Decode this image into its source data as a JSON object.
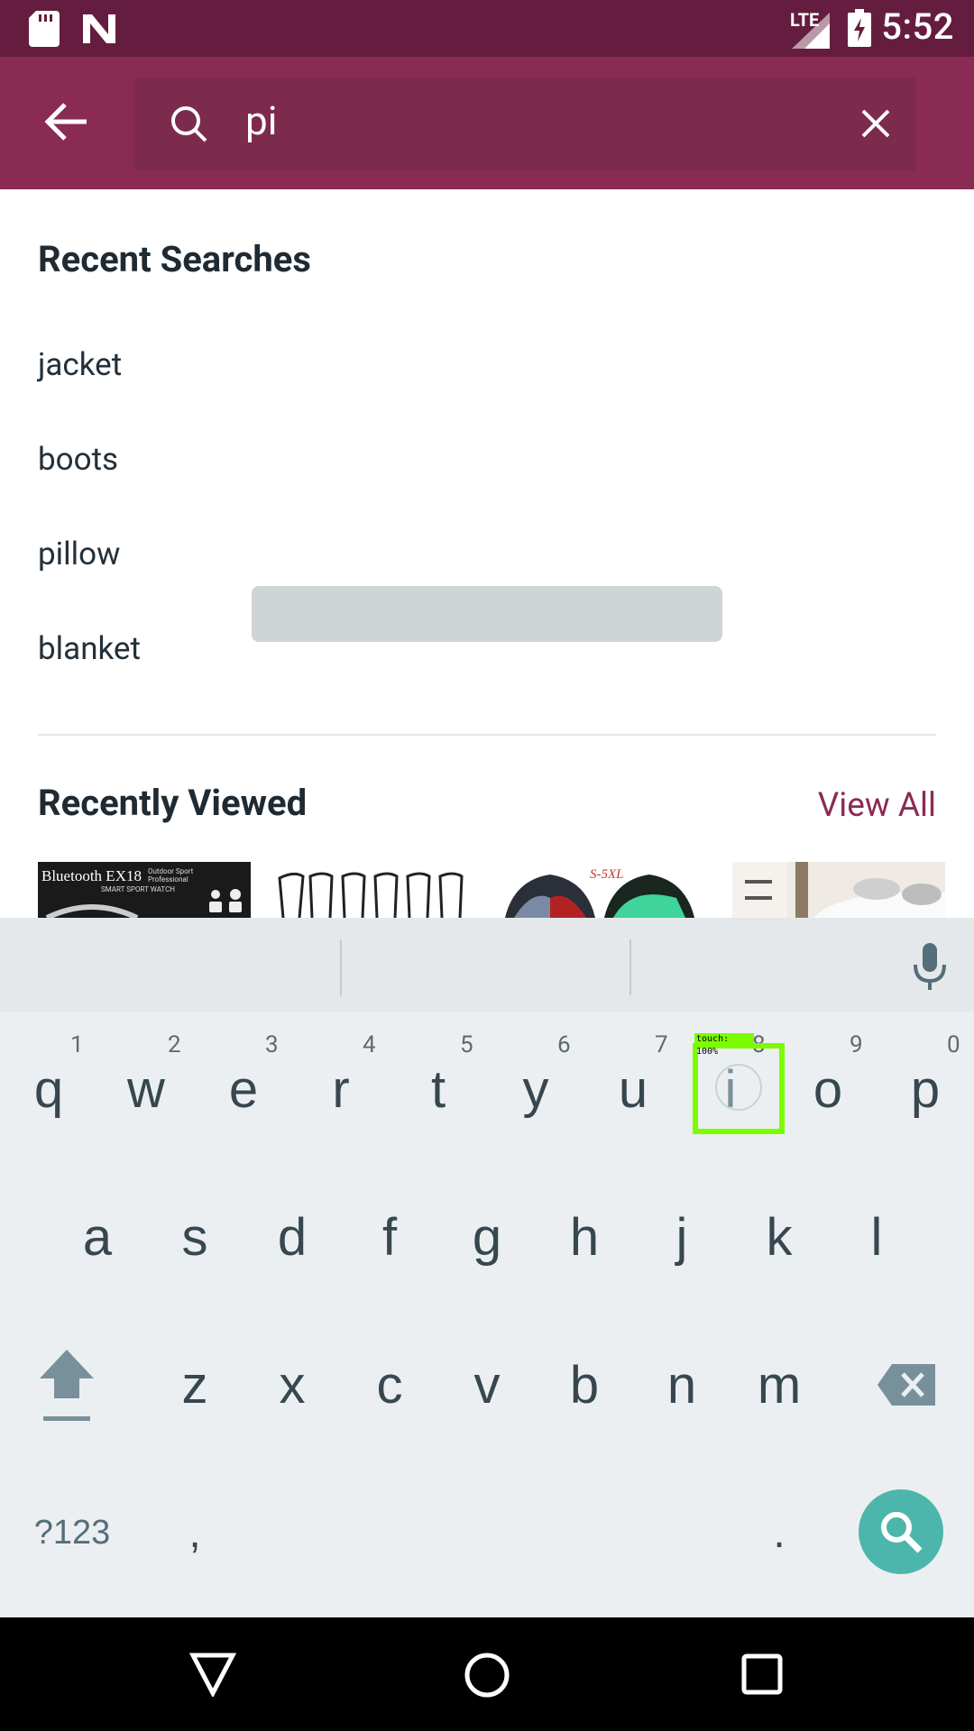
{
  "status_bar": {
    "time": "5:52",
    "network_label": "LTE",
    "icons": [
      "sd-card-icon",
      "n-notification-icon",
      "signal-icon",
      "battery-charging-icon"
    ]
  },
  "app_bar": {
    "back_icon": "arrow-back-icon",
    "search_icon": "search-icon",
    "search_value": "pi",
    "clear_icon": "close-icon"
  },
  "recent_searches": {
    "title": "Recent Searches",
    "items": [
      "jacket",
      "boots",
      "pillow",
      "blanket"
    ]
  },
  "recently_viewed": {
    "title": "Recently Viewed",
    "view_all": "View All",
    "thumb1_text": "Bluetooth EX18",
    "thumb1_small": "Outdoor Sport Professional",
    "thumb1_small2": "SMART SPORT WATCH",
    "thumb3_text": "S-5XL"
  },
  "keyboard": {
    "row1": [
      "q",
      "w",
      "e",
      "r",
      "t",
      "y",
      "u",
      "i",
      "o",
      "p"
    ],
    "row1_hints": [
      "1",
      "2",
      "3",
      "4",
      "5",
      "6",
      "7",
      "8",
      "9",
      "0"
    ],
    "row2": [
      "a",
      "s",
      "d",
      "f",
      "g",
      "h",
      "j",
      "k",
      "l"
    ],
    "row3": [
      "z",
      "x",
      "c",
      "v",
      "b",
      "n",
      "m"
    ],
    "symbols_label": "?123",
    "comma": ",",
    "period": ".",
    "touch_label": "touch: 100%"
  },
  "colors": {
    "status_bar": "#651d3f",
    "app_bar": "#8a2b53",
    "accent": "#8a2b53",
    "keyboard_bg": "#eceff1",
    "fab": "#4db6ac"
  }
}
